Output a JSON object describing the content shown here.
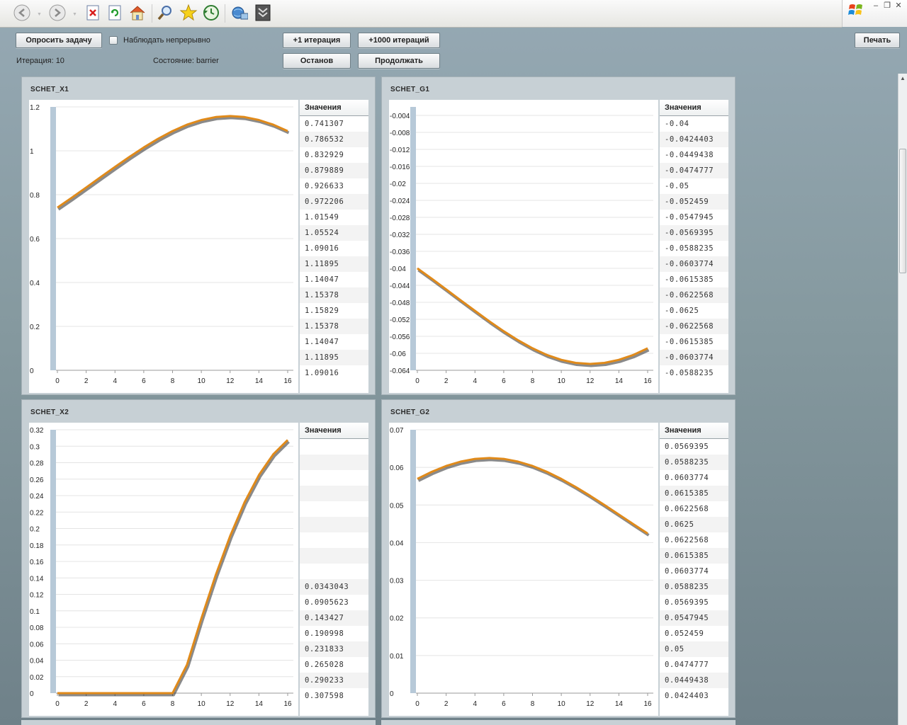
{
  "toolbar": {
    "icons": [
      "back-icon",
      "forward-icon",
      "stop-icon",
      "refresh-icon",
      "home-icon",
      "search-icon",
      "favorites-icon",
      "history-icon",
      "media-icon",
      "print-preview-icon"
    ]
  },
  "controls": {
    "poll_button": "Опросить задачу",
    "watch_label": "Наблюдать непрерывно",
    "watch_checked": false,
    "iter1_button": "+1 итерация",
    "iter1000_button": "+1000 итераций",
    "stop_button": "Останов",
    "continue_button": "Продолжать",
    "print_button": "Печать",
    "iteration_text": "Итерация: 10",
    "state_text": "Состояние: barrier"
  },
  "colors": {
    "line": "#e08a1a",
    "shadow": "#2a2a2a",
    "axis_band": "#b7c9d8",
    "grid": "#e4e4e4"
  },
  "values_header": "Значения",
  "panels": [
    {
      "title": "SCHET_X1",
      "table": [
        "0.741307",
        "0.786532",
        "0.832929",
        "0.879889",
        "0.926633",
        "0.972206",
        "1.01549",
        "1.05524",
        "1.09016",
        "1.11895",
        "1.14047",
        "1.15378",
        "1.15829",
        "1.15378",
        "1.14047",
        "1.11895",
        "1.09016"
      ],
      "chart_data": {
        "type": "line",
        "x": [
          0,
          1,
          2,
          3,
          4,
          5,
          6,
          7,
          8,
          9,
          10,
          11,
          12,
          13,
          14,
          15,
          16
        ],
        "series": [
          {
            "values": [
              0.741307,
              0.786532,
              0.832929,
              0.879889,
              0.926633,
              0.972206,
              1.01549,
              1.05524,
              1.09016,
              1.11895,
              1.14047,
              1.15378,
              1.15829,
              1.15378,
              1.14047,
              1.11895,
              1.09016
            ]
          }
        ],
        "xticks": [
          "0",
          "2",
          "4",
          "6",
          "8",
          "10",
          "12",
          "14",
          "16"
        ],
        "yticks": [
          "0",
          "0.2",
          "0.4",
          "0.6",
          "0.8",
          "1",
          "1.2"
        ],
        "ylim": [
          0,
          1.2
        ],
        "xlim": [
          0,
          16
        ]
      }
    },
    {
      "title": "SCHET_G1",
      "table": [
        "-0.04",
        "-0.0424403",
        "-0.0449438",
        "-0.0474777",
        "-0.05",
        "-0.052459",
        "-0.0547945",
        "-0.0569395",
        "-0.0588235",
        "-0.0603774",
        "-0.0615385",
        "-0.0622568",
        "-0.0625",
        "-0.0622568",
        "-0.0615385",
        "-0.0603774",
        "-0.0588235"
      ],
      "chart_data": {
        "type": "line",
        "x": [
          0,
          1,
          2,
          3,
          4,
          5,
          6,
          7,
          8,
          9,
          10,
          11,
          12,
          13,
          14,
          15,
          16
        ],
        "series": [
          {
            "values": [
              -0.04,
              -0.0424403,
              -0.0449438,
              -0.0474777,
              -0.05,
              -0.052459,
              -0.0547945,
              -0.0569395,
              -0.0588235,
              -0.0603774,
              -0.0615385,
              -0.0622568,
              -0.0625,
              -0.0622568,
              -0.0615385,
              -0.0603774,
              -0.0588235
            ]
          }
        ],
        "xticks": [
          "0",
          "2",
          "4",
          "6",
          "8",
          "10",
          "12",
          "14",
          "16"
        ],
        "yticks": [
          "-0.064",
          "-0.06",
          "-0.056",
          "-0.052",
          "-0.048",
          "-0.044",
          "-0.04",
          "-0.036",
          "-0.032",
          "-0.028",
          "-0.024",
          "-0.02",
          "-0.016",
          "-0.012",
          "-0.008",
          "-0.004"
        ],
        "ylim": [
          -0.064,
          -0.002
        ],
        "xlim": [
          0,
          16
        ]
      }
    },
    {
      "title": "SCHET_X2",
      "table": [
        "",
        "",
        "",
        "",
        "",
        "",
        "",
        "",
        "",
        "0.0343043",
        "0.0905623",
        "0.143427",
        "0.190998",
        "0.231833",
        "0.265028",
        "0.290233",
        "0.307598"
      ],
      "chart_data": {
        "type": "line",
        "x": [
          0,
          1,
          2,
          3,
          4,
          5,
          6,
          7,
          8,
          9,
          10,
          11,
          12,
          13,
          14,
          15,
          16
        ],
        "series": [
          {
            "values": [
              0,
              0,
              0,
              0,
              0,
              0,
              0,
              0,
              0,
              0.0343043,
              0.0905623,
              0.143427,
              0.190998,
              0.231833,
              0.265028,
              0.290233,
              0.307598
            ]
          }
        ],
        "xticks": [
          "0",
          "2",
          "4",
          "6",
          "8",
          "10",
          "12",
          "14",
          "16"
        ],
        "yticks": [
          "0",
          "0.02",
          "0.04",
          "0.06",
          "0.08",
          "0.1",
          "0.12",
          "0.14",
          "0.16",
          "0.18",
          "0.2",
          "0.22",
          "0.24",
          "0.26",
          "0.28",
          "0.3",
          "0.32"
        ],
        "ylim": [
          0,
          0.32
        ],
        "xlim": [
          0,
          16
        ]
      }
    },
    {
      "title": "SCHET_G2",
      "table": [
        "0.0569395",
        "0.0588235",
        "0.0603774",
        "0.0615385",
        "0.0622568",
        "0.0625",
        "0.0622568",
        "0.0615385",
        "0.0603774",
        "0.0588235",
        "0.0569395",
        "0.0547945",
        "0.052459",
        "0.05",
        "0.0474777",
        "0.0449438",
        "0.0424403"
      ],
      "chart_data": {
        "type": "line",
        "x": [
          0,
          1,
          2,
          3,
          4,
          5,
          6,
          7,
          8,
          9,
          10,
          11,
          12,
          13,
          14,
          15,
          16
        ],
        "series": [
          {
            "values": [
              0.0569395,
              0.0588235,
              0.0603774,
              0.0615385,
              0.0622568,
              0.0625,
              0.0622568,
              0.0615385,
              0.0603774,
              0.0588235,
              0.0569395,
              0.0547945,
              0.052459,
              0.05,
              0.0474777,
              0.0449438,
              0.0424403
            ]
          }
        ],
        "xticks": [
          "0",
          "2",
          "4",
          "6",
          "8",
          "10",
          "12",
          "14",
          "16"
        ],
        "yticks": [
          "0",
          "0.01",
          "0.02",
          "0.03",
          "0.04",
          "0.05",
          "0.06",
          "0.07"
        ],
        "ylim": [
          0,
          0.07
        ],
        "xlim": [
          0,
          16
        ]
      }
    }
  ]
}
